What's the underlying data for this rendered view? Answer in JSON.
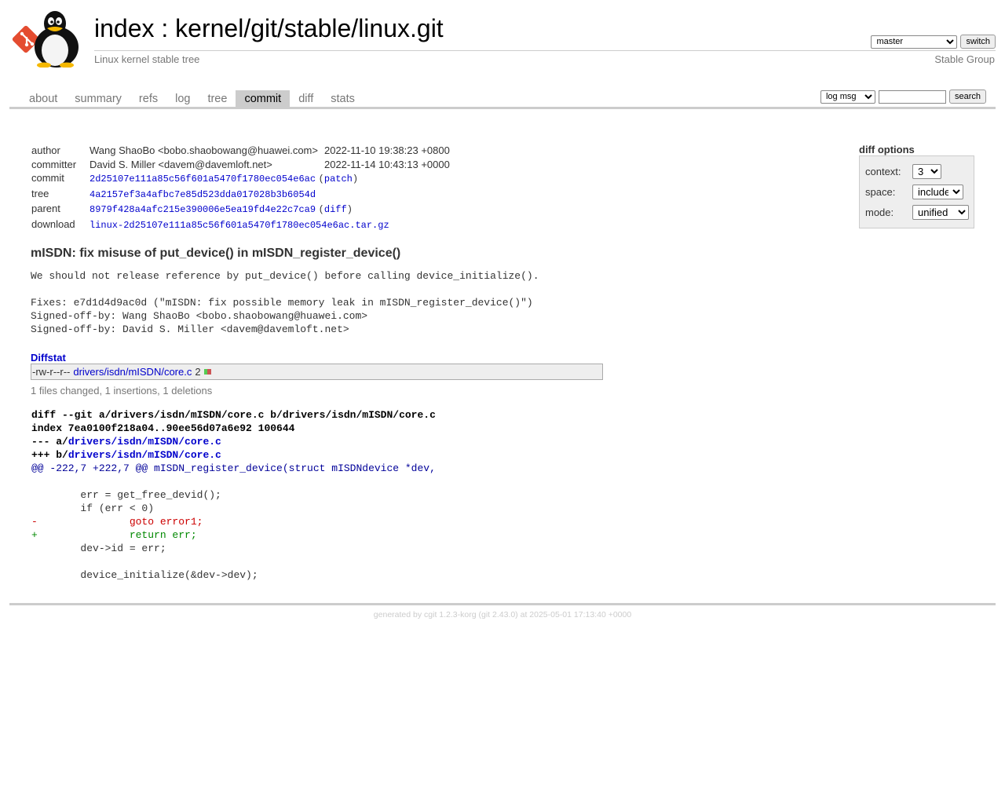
{
  "header": {
    "index_label": "index",
    "separator": " : ",
    "repo_path": "kernel/git/stable/linux.git",
    "description": "Linux kernel stable tree",
    "owner": "Stable Group",
    "branch_selected": "master",
    "switch_label": "switch"
  },
  "tabs": [
    {
      "label": "about"
    },
    {
      "label": "summary"
    },
    {
      "label": "refs"
    },
    {
      "label": "log"
    },
    {
      "label": "tree"
    },
    {
      "label": "commit"
    },
    {
      "label": "diff"
    },
    {
      "label": "stats"
    }
  ],
  "active_tab": "commit",
  "search": {
    "select_value": "log msg",
    "input_value": "",
    "button_label": "search"
  },
  "commit_info": {
    "author_label": "author",
    "author": "Wang ShaoBo <bobo.shaobowang@huawei.com>",
    "author_date": "2022-11-10 19:38:23 +0800",
    "committer_label": "committer",
    "committer": "David S. Miller <davem@davemloft.net>",
    "committer_date": "2022-11-14 10:43:13 +0000",
    "commit_label": "commit",
    "commit_sha": "2d25107e111a85c56f601a5470f1780ec054e6ac",
    "patch_link": "patch",
    "tree_label": "tree",
    "tree_sha": "4a2157ef3a4afbc7e85d523dda017028b3b6054d",
    "parent_label": "parent",
    "parent_sha": "8979f428a4afc215e390006e5ea19fd4e22c7ca9",
    "diff_link": "diff",
    "download_label": "download",
    "download_file": "linux-2d25107e111a85c56f601a5470f1780ec054e6ac.tar.gz"
  },
  "diff_options": {
    "title": "diff options",
    "context_label": "context:",
    "context_value": "3",
    "space_label": "space:",
    "space_value": "include",
    "mode_label": "mode:",
    "mode_value": "unified"
  },
  "subject": "mISDN: fix misuse of put_device() in mISDN_register_device()",
  "message": "We should not release reference by put_device() before calling device_initialize().\n\nFixes: e7d1d4d9ac0d (\"mISDN: fix possible memory leak in mISDN_register_device()\")\nSigned-off-by: Wang ShaoBo <bobo.shaobowang@huawei.com>\nSigned-off-by: David S. Miller <davem@davemloft.net>",
  "diffstat": {
    "header": "Diffstat",
    "mode": "-rw-r--r--",
    "file": "drivers/isdn/mISDN/core.c",
    "count": "2",
    "insertions": 1,
    "deletions": 1,
    "summary": "1 files changed, 1 insertions, 1 deletions"
  },
  "diff": {
    "header_line": "diff --git a/drivers/isdn/mISDN/core.c b/drivers/isdn/mISDN/core.c",
    "index_line": "index 7ea0100f218a04..90ee56d07a6e92 100644",
    "minus_prefix": "--- a/",
    "plus_prefix": "+++ b/",
    "file_path": "drivers/isdn/mISDN/core.c",
    "hunk_header": "@@ -222,7 +222,7 @@ mISDN_register_device(struct mISDNdevice *dev,",
    "lines": [
      {
        "type": "ctx",
        "text": " "
      },
      {
        "type": "ctx",
        "text": " \terr = get_free_devid();"
      },
      {
        "type": "ctx",
        "text": " \tif (err < 0)"
      },
      {
        "type": "del",
        "text": "-\t\tgoto error1;"
      },
      {
        "type": "add",
        "text": "+\t\treturn err;"
      },
      {
        "type": "ctx",
        "text": " \tdev->id = err;"
      },
      {
        "type": "ctx",
        "text": " "
      },
      {
        "type": "ctx",
        "text": " \tdevice_initialize(&dev->dev);"
      }
    ]
  },
  "footer": {
    "prefix": "generated by ",
    "cgit": "cgit 1.2.3-korg",
    "git": "(git 2.43.0)",
    "suffix": " at 2025-05-01 17:13:40 +0000"
  }
}
